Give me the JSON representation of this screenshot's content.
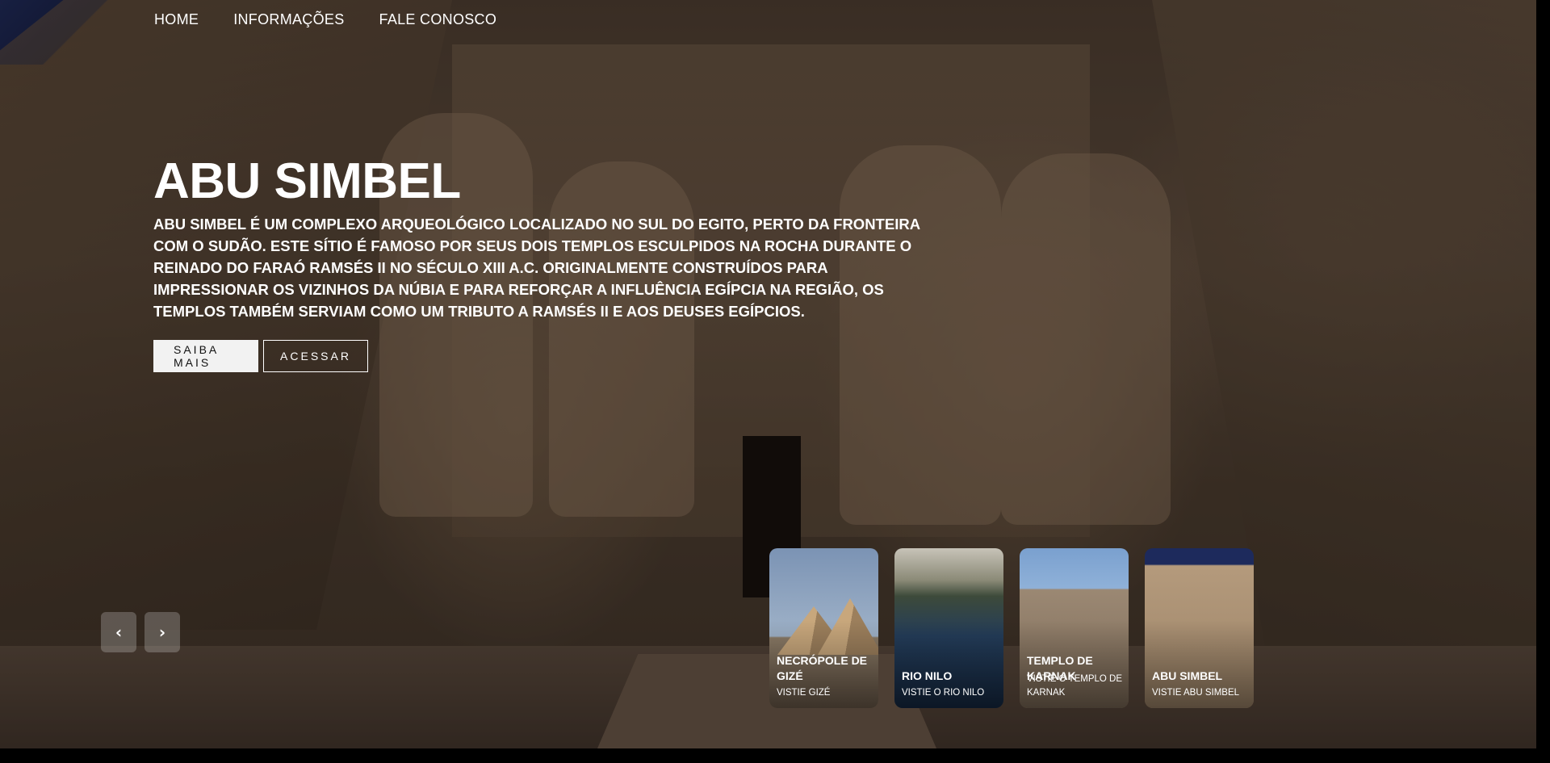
{
  "nav": {
    "items": [
      {
        "label": "HOME"
      },
      {
        "label": "INFORMAÇÕES"
      },
      {
        "label": "FALE CONOSCO"
      }
    ]
  },
  "hero": {
    "title": "ABU SIMBEL",
    "description": "ABU SIMBEL É UM COMPLEXO ARQUEOLÓGICO LOCALIZADO NO SUL DO EGITO, PERTO DA FRONTEIRA COM O SUDÃO. ESTE SÍTIO É FAMOSO POR SEUS DOIS TEMPLOS ESCULPIDOS NA ROCHA DURANTE O REINADO DO FARAÓ RAMSÉS II NO SÉCULO XIII A.C. ORIGINALMENTE CONSTRUÍDOS PARA IMPRESSIONAR OS VIZINHOS DA NÚBIA E PARA REFORÇAR A INFLUÊNCIA EGÍPCIA NA REGIÃO, OS TEMPLOS TAMBÉM SERVIAM COMO UM TRIBUTO A RAMSÉS II E AOS DEUSES EGÍPCIOS.",
    "primary_button": "SAIBA MAIS",
    "secondary_button": "ACESSAR"
  },
  "carousel": {
    "prev_icon": "‹",
    "next_icon": "›",
    "items": [
      {
        "title": "NECRÓPOLE DE GIZÉ",
        "subtitle": "VISTIE GIZÉ"
      },
      {
        "title": "RIO NILO",
        "subtitle": "VISTIE O RIO NILO"
      },
      {
        "title": "TEMPLO DE KARNAK",
        "subtitle": "VISTIE O TEMPLO DE KARNAK"
      },
      {
        "title": "ABU SIMBEL",
        "subtitle": "VISTIE ABU SIMBEL"
      }
    ]
  }
}
